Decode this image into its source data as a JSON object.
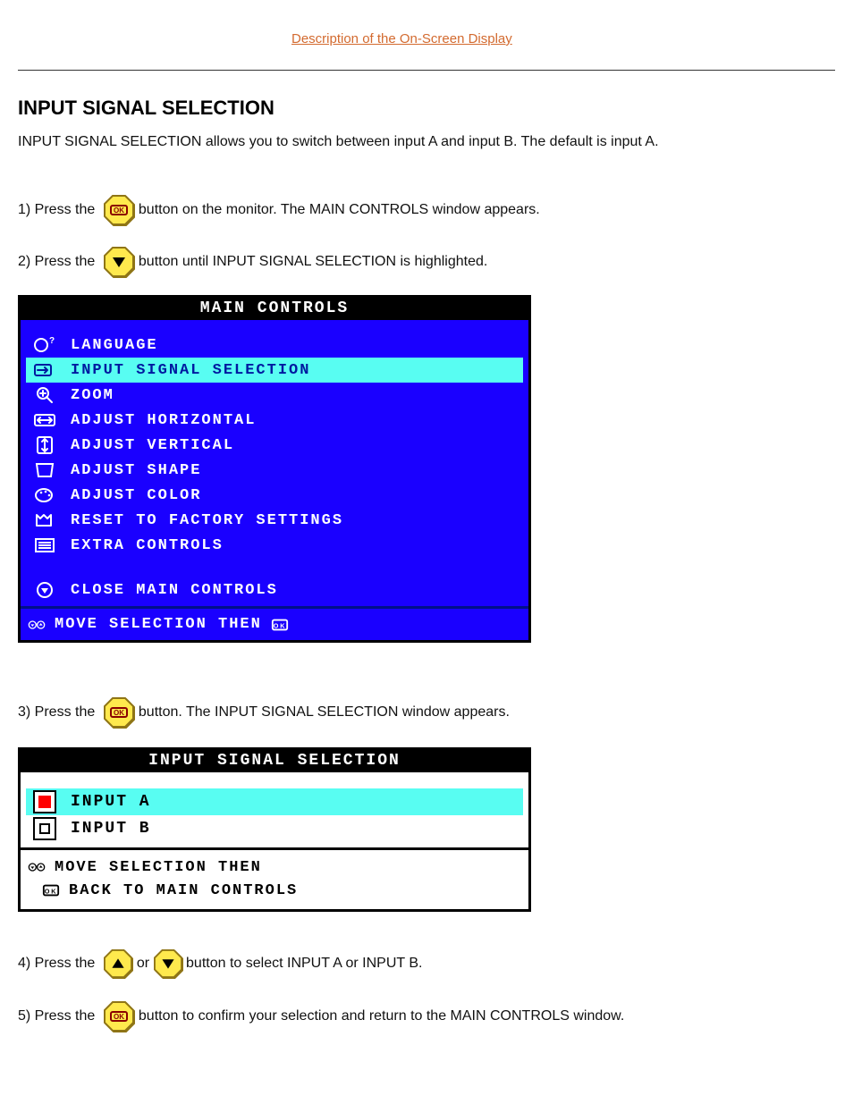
{
  "top": {
    "func_link": "Description of the On-Screen Display",
    "heading": "INPUT SIGNAL SELECTION",
    "intro": "INPUT SIGNAL SELECTION allows you to switch between input A and input B. The default is input A."
  },
  "steps": {
    "s1_num": "1) Press the",
    "s1_after": " button on the monitor. The MAIN CONTROLS window appears.",
    "s2_num": "2) Press the",
    "s2_after": " button until INPUT SIGNAL SELECTION is highlighted.",
    "s3_num": "3) Press the",
    "s3_after": " button. The INPUT SIGNAL SELECTION window appears.",
    "s4_num": "4) Press the",
    "s4_mid": " or ",
    "s4_after": " button to select INPUT A or INPUT B.",
    "s5_num": "5) Press the",
    "s5_after": " button to confirm your selection and return to the MAIN CONTROLS window."
  },
  "osd_main": {
    "title": "MAIN CONTROLS",
    "items": [
      {
        "label": "LANGUAGE"
      },
      {
        "label": "INPUT SIGNAL SELECTION",
        "hl": true
      },
      {
        "label": "ZOOM"
      },
      {
        "label": "ADJUST HORIZONTAL"
      },
      {
        "label": "ADJUST VERTICAL"
      },
      {
        "label": "ADJUST SHAPE"
      },
      {
        "label": "ADJUST COLOR"
      },
      {
        "label": "RESET TO FACTORY SETTINGS"
      },
      {
        "label": "EXTRA CONTROLS"
      }
    ],
    "close": "CLOSE MAIN CONTROLS",
    "footer": "MOVE SELECTION THEN"
  },
  "osd_sel": {
    "title": "INPUT SIGNAL SELECTION",
    "inputA": "INPUT A",
    "inputB": "INPUT B",
    "footer1": "MOVE SELECTION THEN",
    "footer2": "BACK TO MAIN CONTROLS"
  }
}
